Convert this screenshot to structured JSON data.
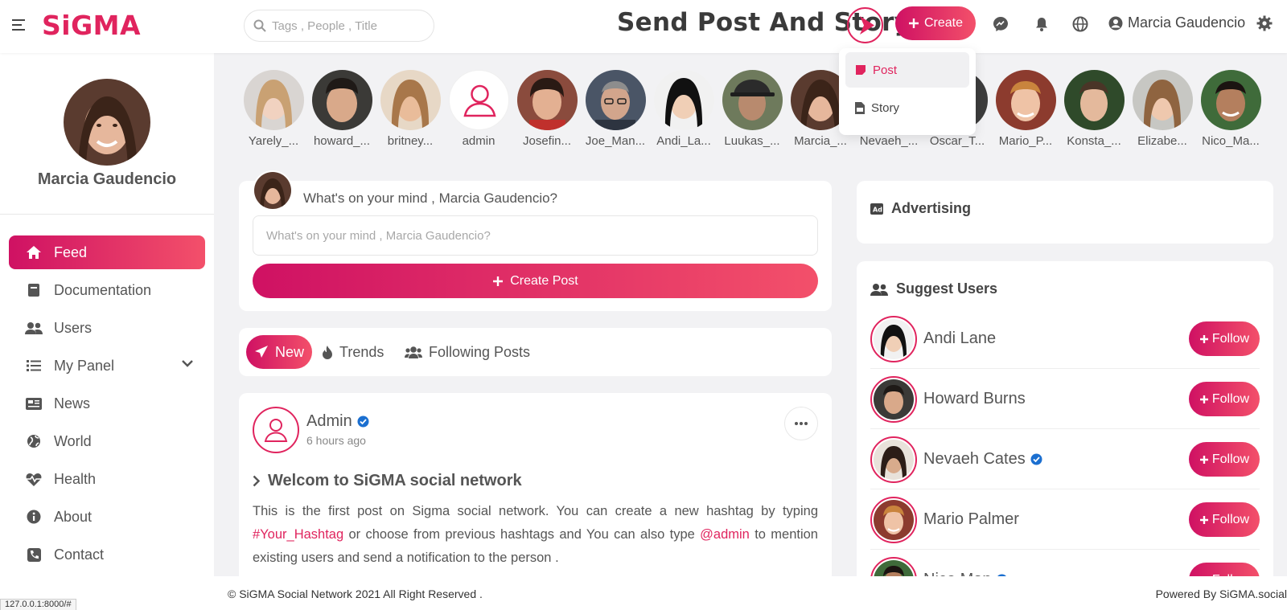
{
  "header": {
    "logo": "SiGMA",
    "search_placeholder": "Tags , People , Title",
    "headline": "Send Post And Story",
    "create_label": "Create",
    "user_name": "Marcia Gaudencio",
    "icons": [
      "menu-icon",
      "search-icon",
      "messenger-icon",
      "bell-icon",
      "globe-icon",
      "user-circle-icon",
      "gear-icon"
    ]
  },
  "create_menu": {
    "items": [
      {
        "label": "Post",
        "active": true
      },
      {
        "label": "Story",
        "active": false
      }
    ]
  },
  "sidebar": {
    "profile_name": "Marcia Gaudencio",
    "items": [
      {
        "label": "Feed",
        "icon": "home-icon",
        "active": true
      },
      {
        "label": "Documentation",
        "icon": "book-icon"
      },
      {
        "label": "Users",
        "icon": "users-icon"
      },
      {
        "label": "My Panel",
        "icon": "list-icon",
        "expandable": true
      },
      {
        "label": "News",
        "icon": "newspaper-icon"
      },
      {
        "label": "World",
        "icon": "globe-icon"
      },
      {
        "label": "Health",
        "icon": "heartbeat-icon"
      },
      {
        "label": "About",
        "icon": "info-icon"
      },
      {
        "label": "Contact",
        "icon": "phone-icon"
      }
    ]
  },
  "stories": [
    {
      "name": "Yarely_..."
    },
    {
      "name": "howard_..."
    },
    {
      "name": "britney..."
    },
    {
      "name": "admin"
    },
    {
      "name": "Josefin..."
    },
    {
      "name": "Joe_Man..."
    },
    {
      "name": "Andi_La..."
    },
    {
      "name": "Luukas_..."
    },
    {
      "name": "Marcia_..."
    },
    {
      "name": "Nevaeh_..."
    },
    {
      "name": "Oscar_T..."
    },
    {
      "name": "Mario_P..."
    },
    {
      "name": "Konsta_..."
    },
    {
      "name": "Elizabe..."
    },
    {
      "name": "Nico_Ma..."
    }
  ],
  "composer": {
    "prompt": "What's on your mind , Marcia Gaudencio?",
    "placeholder": "What's on your mind , Marcia Gaudencio?",
    "button": "Create Post"
  },
  "feed_tabs": [
    {
      "label": "New",
      "icon": "paper-plane-icon",
      "active": true
    },
    {
      "label": "Trends",
      "icon": "fire-icon"
    },
    {
      "label": "Following Posts",
      "icon": "users-icon"
    }
  ],
  "post": {
    "author": "Admin",
    "time": "6 hours ago",
    "title": "Welcom to SiGMA social network",
    "body_1": "This is the first post on Sigma social network. You can create a new hashtag by typing ",
    "hashtag": "#Your_Hashtag",
    "body_2": " or choose from previous hashtags and You can also type ",
    "mention": "@admin",
    "body_3": " to mention existing users and send a notification to the person ."
  },
  "advertising": {
    "title": "Advertising"
  },
  "suggest_users": {
    "title": "Suggest Users",
    "follow_label": "Follow",
    "users": [
      {
        "name": "Andi Lane",
        "verified": false
      },
      {
        "name": "Howard Burns",
        "verified": false
      },
      {
        "name": "Nevaeh Cates",
        "verified": true
      },
      {
        "name": "Mario Palmer",
        "verified": false
      },
      {
        "name": "Nico Man",
        "verified": true
      }
    ]
  },
  "footer": {
    "copyright": "© SiGMA Social Network 2021 All Right Reserved .",
    "powered": "Powered By SiGMA.social"
  },
  "status_url": "127.0.0.1:8000/#",
  "colors": {
    "accent": "#e0245e",
    "accent_light": "#f3506a",
    "background": "#f2f2f4"
  }
}
